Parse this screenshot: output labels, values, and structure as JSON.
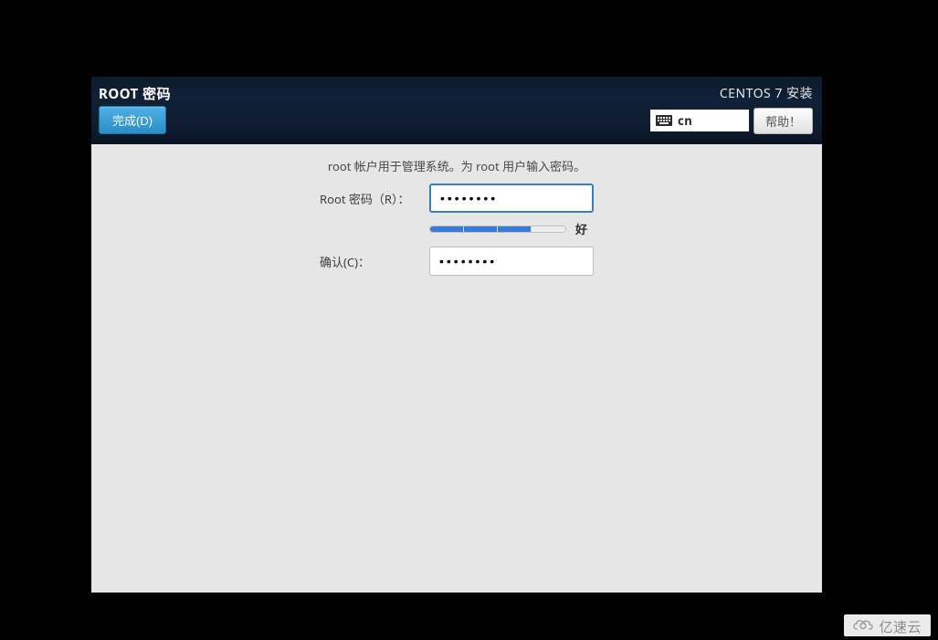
{
  "header": {
    "title_left": "ROOT 密码",
    "title_right": "CENTOS 7 安装",
    "done_label": "完成(D)",
    "help_label": "帮助！",
    "keyboard": {
      "layout": "cn"
    }
  },
  "content": {
    "description": "root 帐户用于管理系统。为 root 用户输入密码。",
    "root_password_label": "Root 密码（R）：",
    "root_password_value": "••••••••",
    "confirm_label": "确认(C)：",
    "confirm_value": "••••••••",
    "strength_text": "好"
  },
  "watermark": {
    "text": "亿速云"
  }
}
